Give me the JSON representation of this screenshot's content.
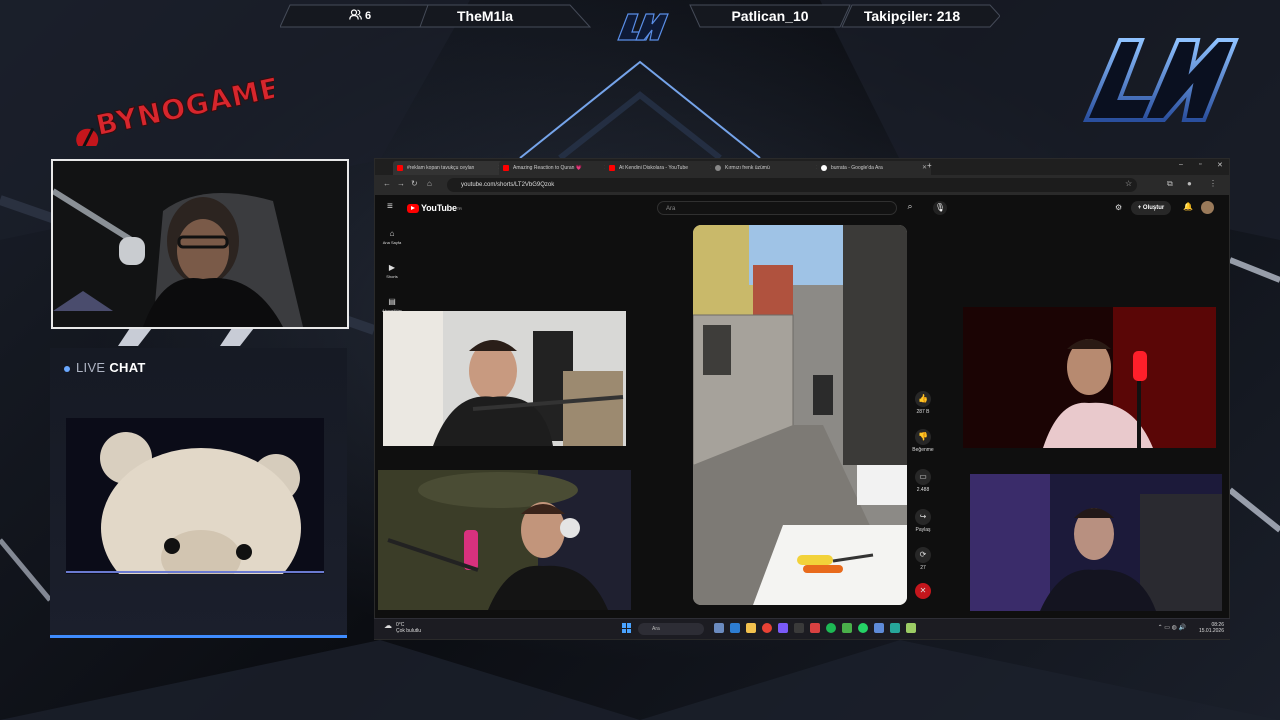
{
  "overlay": {
    "viewer_count": "6",
    "left_name": "TheM1la",
    "right_name": "Patlican_10",
    "followers": "Takipçiler: 218",
    "brand_text": "BYNOGAME",
    "chat_live": "LIVE",
    "chat_word": "CHAT",
    "accent_color": "#3f8cff"
  },
  "browser": {
    "tabs": [
      {
        "label": "#reklam kopan tavukçu ceylan",
        "active": true,
        "icon": "youtube-icon"
      },
      {
        "label": "Amazing Reaction to Quran 💗",
        "active": false,
        "icon": "youtube-icon"
      },
      {
        "label": "At Kendini Diskolara - YouTube",
        "active": false,
        "icon": "youtube-icon"
      },
      {
        "label": "Kırmızı frenk üzümü",
        "active": false,
        "icon": "web-icon"
      },
      {
        "label": "burrata - Google'da Ara",
        "active": false,
        "icon": "google-icon"
      }
    ],
    "new_tab": "+",
    "url": "youtube.com/shorts/LT2VbG9Qzok",
    "window_controls": [
      "–",
      "▫",
      "✕"
    ]
  },
  "youtube": {
    "logo": "YouTube",
    "logo_sup": "TR",
    "search_placeholder": "Ara",
    "create_label": "Oluştur",
    "sidebar": [
      {
        "label": "Ana Sayfa",
        "icon": "home-icon"
      },
      {
        "label": "Shorts",
        "icon": "shorts-icon"
      },
      {
        "label": "Abonelikler",
        "icon": "subscriptions-icon"
      }
    ],
    "actions": [
      {
        "label": "287 B",
        "icon": "like-icon"
      },
      {
        "label": "Beğenme",
        "icon": "dislike-icon"
      },
      {
        "label": "2.488",
        "icon": "comment-icon"
      },
      {
        "label": "Paylaş",
        "icon": "share-icon"
      },
      {
        "label": "27",
        "icon": "remix-icon"
      }
    ]
  },
  "taskbar": {
    "weather_temp": "0°C",
    "weather_desc": "Çok bulutlu",
    "search": "Ara",
    "time": "08:26",
    "date": "15.01.2026"
  }
}
